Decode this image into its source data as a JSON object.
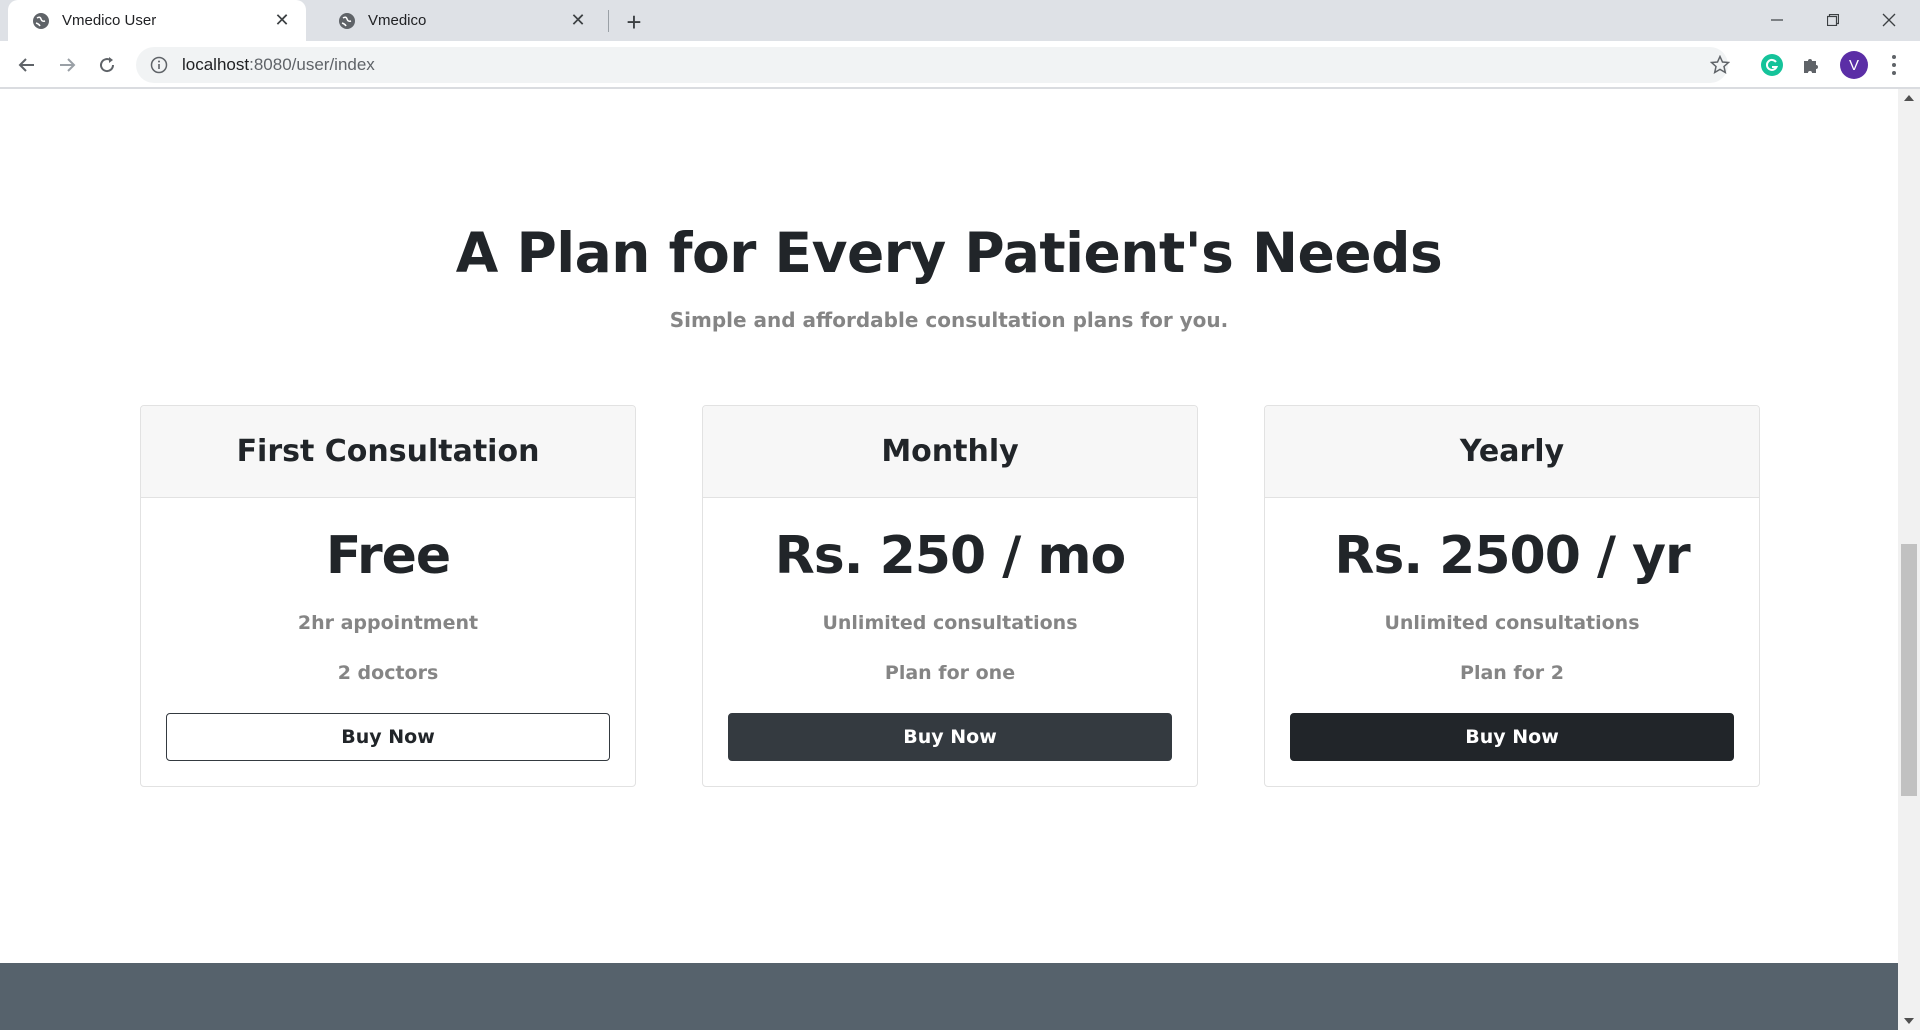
{
  "browser": {
    "tabs": [
      {
        "title": "Vmedico User",
        "active": true
      },
      {
        "title": "Vmedico",
        "active": false
      }
    ],
    "url_host": "localhost",
    "url_path": ":8080/user/index",
    "avatar_letter": "V"
  },
  "page": {
    "heading": "A Plan for Every Patient's Needs",
    "subheading": "Simple and affordable consultation plans for you.",
    "plans": [
      {
        "name": "First Consultation",
        "price": "Free",
        "features": [
          "2hr appointment",
          "2 doctors"
        ],
        "button": "Buy Now"
      },
      {
        "name": "Monthly",
        "price": "Rs. 250 / mo",
        "features": [
          "Unlimited consultations",
          "Plan for one"
        ],
        "button": "Buy Now"
      },
      {
        "name": "Yearly",
        "price": "Rs. 2500 / yr",
        "features": [
          "Unlimited consultations",
          "Plan for 2"
        ],
        "button": "Buy Now"
      }
    ]
  },
  "colors": {
    "dark_button": "#343a40",
    "darker_button": "#212529",
    "footer": "#56626c",
    "muted_text": "#858585"
  }
}
